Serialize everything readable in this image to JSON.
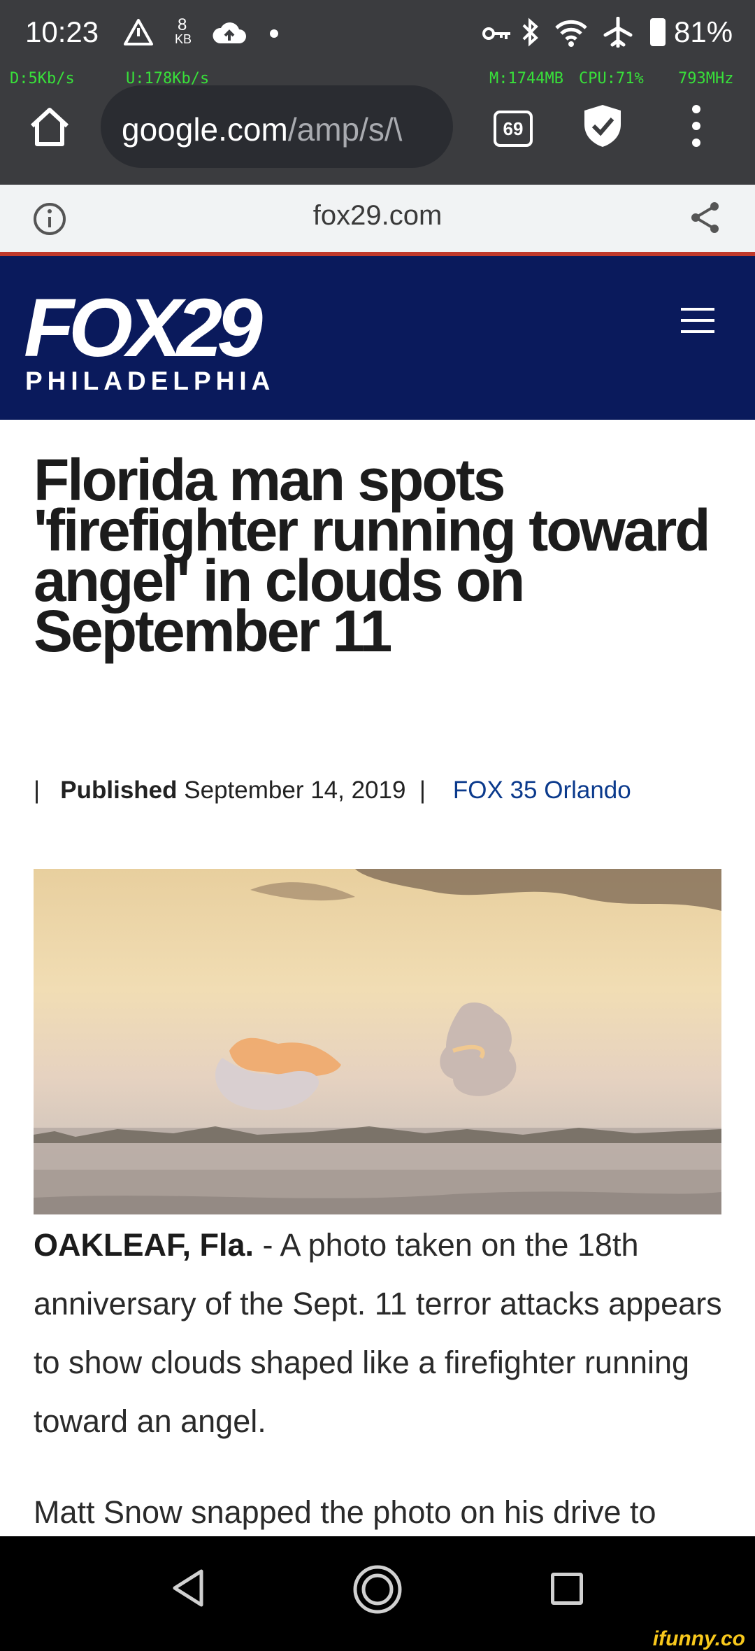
{
  "status_bar": {
    "time": "10:23",
    "net_kb_value": "8",
    "net_kb_unit": "KB",
    "battery": "81%",
    "down_speed": "D:5Kb/s",
    "up_speed": "U:178Kb/s",
    "memory": "M:1744MB",
    "cpu": "CPU:71%",
    "freq": "793MHz"
  },
  "browser": {
    "url_domain": "google.com",
    "url_path": "/amp/s/\\",
    "tab_count": "69"
  },
  "amp_header": {
    "domain": "fox29.com"
  },
  "site_header": {
    "logo_text": "FOX29",
    "logo_subtext": "PHILADELPHIA"
  },
  "article": {
    "headline": "Florida man spots 'firefighter running toward angel' in clouds on September 11",
    "byline_sep1": "|",
    "byline_published_label": "Published",
    "byline_date": "September 14, 2019",
    "byline_sep2": "|",
    "byline_source": "FOX 35 Orlando",
    "dateline": "OAKLEAF, Fla.",
    "para1_rest": " - A photo taken on the 18th anniversary of the Sept. 11 terror attacks appears to show clouds shaped like a firefighter running toward an angel.",
    "para2": "Matt Snow snapped the photo on his drive to"
  },
  "watermark": {
    "text": "ifunny.co"
  },
  "colors": {
    "status_bg": "#3b3c3f",
    "site_header_bg": "#0a1a5c",
    "accent_red": "#c0392b",
    "source_link": "#0b3a8c",
    "speed_text": "#38e03a"
  }
}
